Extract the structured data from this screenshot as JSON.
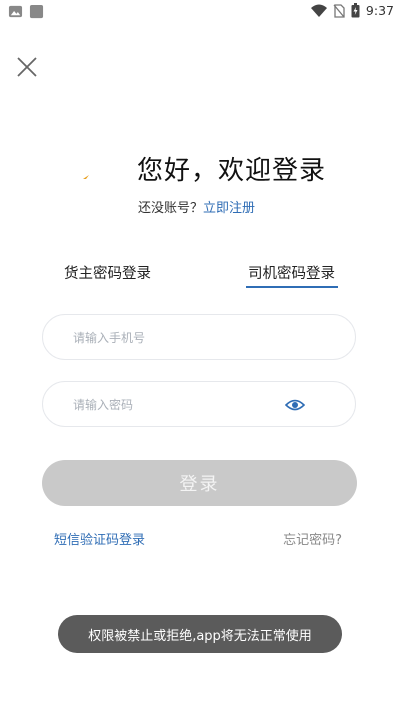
{
  "status_bar": {
    "time": "9:37",
    "icons": [
      "gallery-notification-icon",
      "app-notification-icon",
      "wifi-icon",
      "no-sim-icon",
      "battery-icon"
    ]
  },
  "header": {
    "close_icon": "close-icon",
    "logo_icon": "logo-icon"
  },
  "welcome": {
    "title": "您好，欢迎登录",
    "no_account_text": "还没账号？",
    "register_link": "立即注册"
  },
  "tabs": [
    {
      "label": "货主密码登录",
      "active": false
    },
    {
      "label": "司机密码登录",
      "active": true
    }
  ],
  "form": {
    "phone_placeholder": "请输入手机号",
    "phone_value": "",
    "password_placeholder": "请输入密码",
    "password_value": "",
    "eye_icon": "eye-icon",
    "login_label": "登录"
  },
  "links": {
    "sms_login": "短信验证码登录",
    "forgot_password": "忘记密码?"
  },
  "toast": {
    "message": "权限被禁止或拒绝,app将无法正常使用"
  },
  "colors": {
    "accent": "#2f6db5",
    "disabled_button": "#c9c9c9",
    "toast_bg": "#5b5b5b",
    "field_border": "#e6e8ec"
  }
}
